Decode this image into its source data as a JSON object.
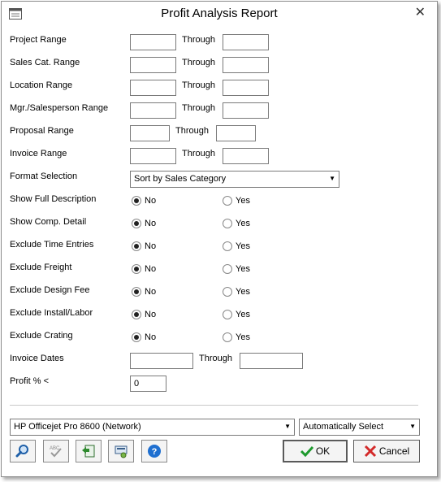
{
  "window": {
    "title": "Profit Analysis Report",
    "close_icon": "close-icon"
  },
  "ranges": [
    {
      "label": "Project Range",
      "through": "Through",
      "from": "",
      "to": ""
    },
    {
      "label": "Sales Cat. Range",
      "through": "Through",
      "from": "",
      "to": ""
    },
    {
      "label": "Location Range",
      "through": "Through",
      "from": "",
      "to": ""
    },
    {
      "label": "Mgr./Salesperson Range",
      "through": "Through",
      "from": "",
      "to": ""
    },
    {
      "label": "Proposal Range",
      "through": "Through",
      "from": "",
      "to": ""
    },
    {
      "label": "Invoice Range",
      "through": "Through",
      "from": "",
      "to": ""
    }
  ],
  "format": {
    "label": "Format Selection",
    "value": "Sort by Sales Category"
  },
  "options": [
    {
      "label": "Show Full Description",
      "no": "No",
      "yes": "Yes",
      "selected": "no"
    },
    {
      "label": "Show Comp. Detail",
      "no": "No",
      "yes": "Yes",
      "selected": "no"
    },
    {
      "label": "Exclude Time Entries",
      "no": "No",
      "yes": "Yes",
      "selected": "no"
    },
    {
      "label": "Exclude Freight",
      "no": "No",
      "yes": "Yes",
      "selected": "no"
    },
    {
      "label": "Exclude Design Fee",
      "no": "No",
      "yes": "Yes",
      "selected": "no"
    },
    {
      "label": "Exclude Install/Labor",
      "no": "No",
      "yes": "Yes",
      "selected": "no"
    },
    {
      "label": "Exclude Crating",
      "no": "No",
      "yes": "Yes",
      "selected": "no"
    }
  ],
  "invoice_dates": {
    "label": "Invoice Dates",
    "through": "Through",
    "from": "",
    "to": ""
  },
  "profit": {
    "label": "Profit % <",
    "value": "0"
  },
  "printer": {
    "value": "HP Officejet Pro 8600 (Network)"
  },
  "tray": {
    "value": "Automatically Select"
  },
  "buttons": {
    "ok": "OK",
    "cancel": "Cancel"
  },
  "colors": {
    "ok_check": "#1e9a2e",
    "cancel_x": "#d32a2a",
    "help_blue": "#1e6fd0"
  }
}
